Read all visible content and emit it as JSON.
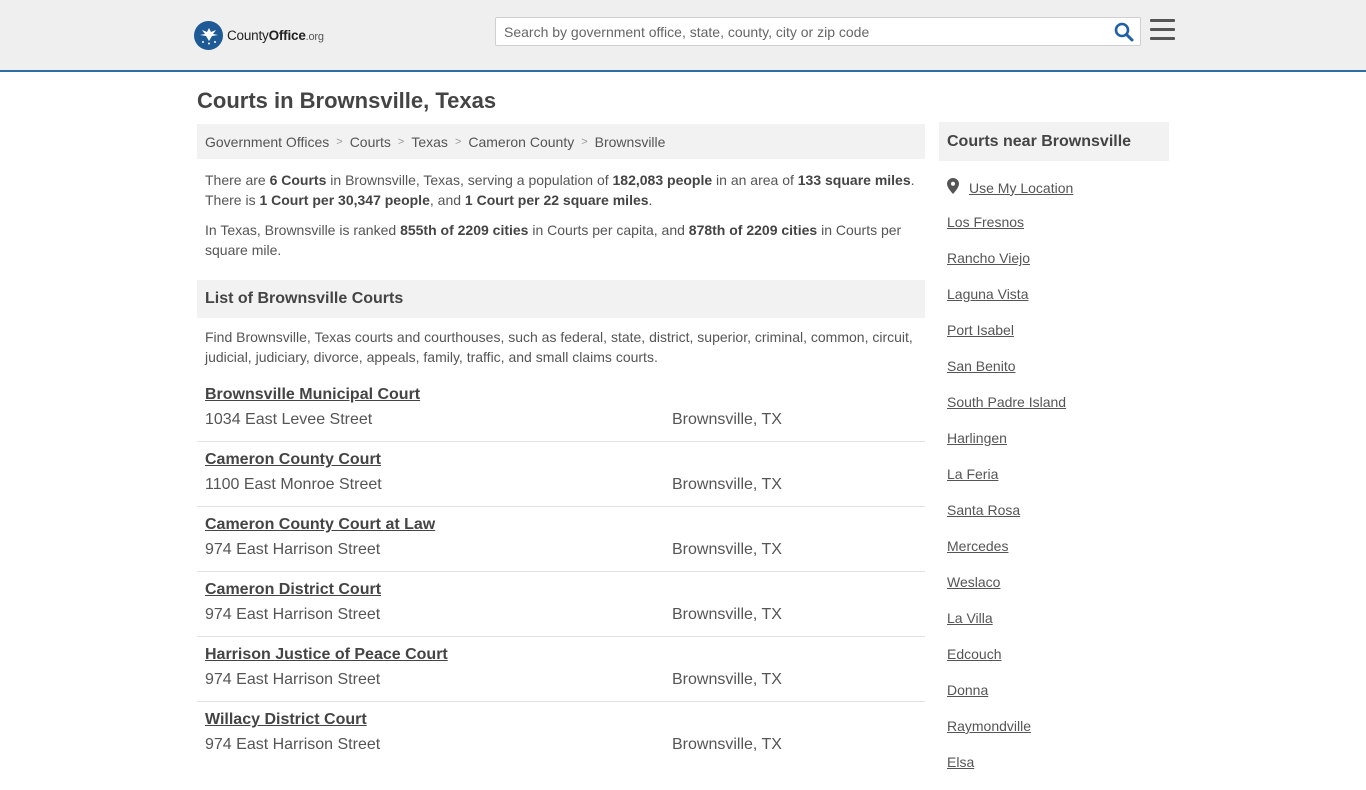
{
  "header": {
    "logo": {
      "brand": "County",
      "office": "Office",
      "tld": ".org"
    },
    "search_placeholder": "Search by government office, state, county, city or zip code",
    "icons": {
      "search": "search-icon",
      "menu": "hamburger-menu-icon"
    }
  },
  "page": {
    "title": "Courts in Brownsville, Texas"
  },
  "breadcrumb": [
    "Government Offices",
    "Courts",
    "Texas",
    "Cameron County",
    "Brownsville"
  ],
  "intro": {
    "p1": {
      "a": "There are ",
      "b1": "6 Courts",
      "c": " in Brownsville, Texas, serving a population of ",
      "b2": "182,083 people",
      "d": " in an area of ",
      "b3": "133 square miles",
      "e": ". There is ",
      "b4": "1 Court per 30,347 people",
      "f": ", and ",
      "b5": "1 Court per 22 square miles",
      "g": "."
    },
    "p2": {
      "a": "In Texas, Brownsville is ranked ",
      "b1": "855th of 2209 cities",
      "c": " in Courts per capita, and ",
      "b2": "878th of 2209 cities",
      "d": " in Courts per square mile."
    }
  },
  "list": {
    "heading": "List of Brownsville Courts",
    "description": "Find Brownsville, Texas courts and courthouses, such as federal, state, district, superior, criminal, common, circuit, judicial, judiciary, divorce, appeals, family, traffic, and small claims courts.",
    "courts": [
      {
        "name": "Brownsville Municipal Court",
        "address": "1034 East Levee Street",
        "city": "Brownsville, TX"
      },
      {
        "name": "Cameron County Court",
        "address": "1100 East Monroe Street",
        "city": "Brownsville, TX"
      },
      {
        "name": "Cameron County Court at Law",
        "address": "974 East Harrison Street",
        "city": "Brownsville, TX"
      },
      {
        "name": "Cameron District Court",
        "address": "974 East Harrison Street",
        "city": "Brownsville, TX"
      },
      {
        "name": "Harrison Justice of Peace Court",
        "address": "974 East Harrison Street",
        "city": "Brownsville, TX"
      },
      {
        "name": "Willacy District Court",
        "address": "974 East Harrison Street",
        "city": "Brownsville, TX"
      }
    ]
  },
  "sidebar": {
    "heading": "Courts near Brownsville",
    "use_location": "Use My Location",
    "cities": [
      "Los Fresnos",
      "Rancho Viejo",
      "Laguna Vista",
      "Port Isabel",
      "San Benito",
      "South Padre Island",
      "Harlingen",
      "La Feria",
      "Santa Rosa",
      "Mercedes",
      "Weslaco",
      "La Villa",
      "Edcouch",
      "Donna",
      "Raymondville",
      "Elsa"
    ]
  },
  "colors": {
    "accent": "#2e6da4",
    "logo": "#1d5a96",
    "search_icon": "#1f5fa8"
  }
}
